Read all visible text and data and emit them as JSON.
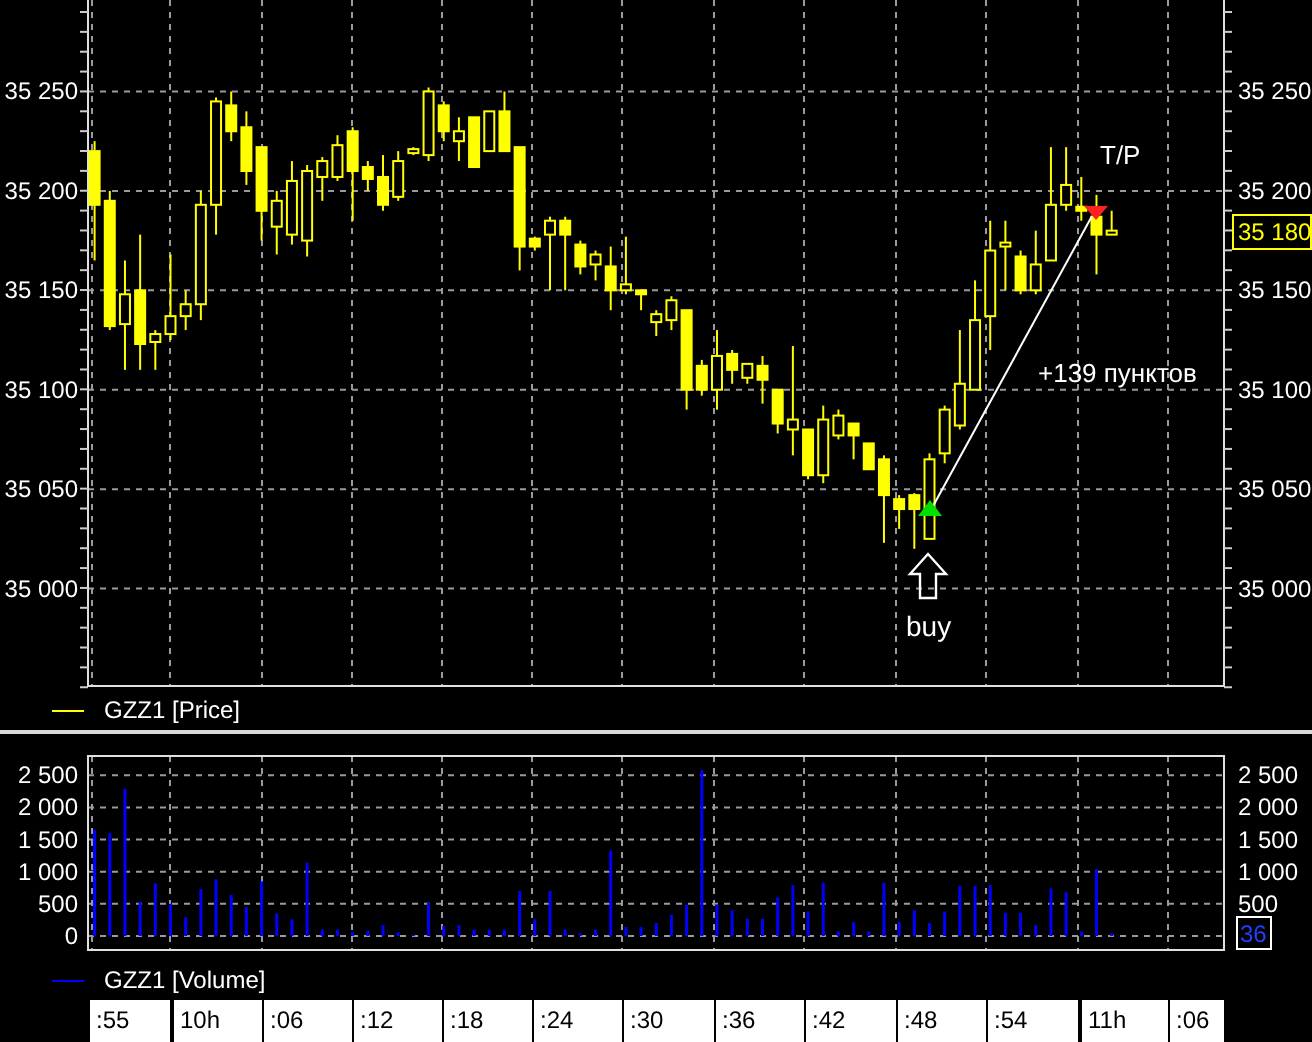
{
  "price_panel": {
    "chart_data": {
      "type": "candlestick",
      "grid": true,
      "ylim": [
        34951,
        35296
      ],
      "yticks": [
        {
          "value": 35000,
          "label": "35 000"
        },
        {
          "value": 35050,
          "label": "35 050"
        },
        {
          "value": 35100,
          "label": "35 100"
        },
        {
          "value": 35150,
          "label": "35 150"
        },
        {
          "value": 35200,
          "label": "35 200"
        },
        {
          "value": 35250,
          "label": "35 250"
        }
      ],
      "series": [
        {
          "name": "GZZ1 [Price]",
          "color": "#ffff00"
        }
      ],
      "ohlc": [
        [
          35220,
          35225,
          35165,
          35193
        ],
        [
          35195,
          35200,
          35130,
          35132
        ],
        [
          35133,
          35165,
          35110,
          35148
        ],
        [
          35150,
          35178,
          35110,
          35123
        ],
        [
          35124,
          35130,
          35110,
          35128
        ],
        [
          35128,
          35168,
          35125,
          35137
        ],
        [
          35137,
          35150,
          35130,
          35143
        ],
        [
          35143,
          35200,
          35135,
          35193
        ],
        [
          35193,
          35247,
          35178,
          35245
        ],
        [
          35243,
          35250,
          35225,
          35230
        ],
        [
          35232,
          35240,
          35203,
          35210
        ],
        [
          35222,
          35222,
          35175,
          35190
        ],
        [
          35182,
          35200,
          35168,
          35195
        ],
        [
          35178,
          35215,
          35173,
          35205
        ],
        [
          35175,
          35213,
          35167,
          35210
        ],
        [
          35207,
          35217,
          35195,
          35215
        ],
        [
          35207,
          35228,
          35205,
          35223
        ],
        [
          35230,
          35232,
          35185,
          35210
        ],
        [
          35212,
          35215,
          35200,
          35206
        ],
        [
          35207,
          35218,
          35190,
          35193
        ],
        [
          35197,
          35220,
          35195,
          35215
        ],
        [
          35219,
          35222,
          35218,
          35221
        ],
        [
          35218,
          35252,
          35215,
          35250
        ],
        [
          35243,
          35245,
          35225,
          35230
        ],
        [
          35225,
          35237,
          35215,
          35230
        ],
        [
          35237,
          35237,
          35212,
          35212
        ],
        [
          35220,
          35240,
          35220,
          35240
        ],
        [
          35240,
          35250,
          35220,
          35220
        ],
        [
          35222,
          35222,
          35160,
          35172
        ],
        [
          35176,
          35177,
          35170,
          35172
        ],
        [
          35178,
          35187,
          35150,
          35185
        ],
        [
          35185,
          35187,
          35150,
          35178
        ],
        [
          35173,
          35175,
          35158,
          35162
        ],
        [
          35163,
          35170,
          35155,
          35168
        ],
        [
          35162,
          35172,
          35140,
          35150
        ],
        [
          35150,
          35177,
          35148,
          35153
        ],
        [
          35150,
          35150,
          35140,
          35148
        ],
        [
          35134,
          35140,
          35127,
          35138
        ],
        [
          35135,
          35147,
          35130,
          35145
        ],
        [
          35140,
          35140,
          35090,
          35100
        ],
        [
          35112,
          35115,
          35097,
          35100
        ],
        [
          35100,
          35130,
          35090,
          35117
        ],
        [
          35118,
          35120,
          35103,
          35110
        ],
        [
          35106,
          35113,
          35103,
          35113
        ],
        [
          35112,
          35117,
          35093,
          35105
        ],
        [
          35100,
          35100,
          35078,
          35083
        ],
        [
          35080,
          35122,
          35067,
          35085
        ],
        [
          35080,
          35080,
          35055,
          35057
        ],
        [
          35057,
          35092,
          35053,
          35085
        ],
        [
          35077,
          35090,
          35075,
          35087
        ],
        [
          35083,
          35083,
          35065,
          35077
        ],
        [
          35073,
          35073,
          35060,
          35060
        ],
        [
          35065,
          35067,
          35023,
          35047
        ],
        [
          35045,
          35047,
          35030,
          35040
        ],
        [
          35047,
          35048,
          35020,
          35040
        ],
        [
          35025,
          35068,
          35025,
          35065
        ],
        [
          35068,
          35092,
          35063,
          35090
        ],
        [
          35082,
          35130,
          35080,
          35103
        ],
        [
          35100,
          35155,
          35100,
          35135
        ],
        [
          35137,
          35185,
          35120,
          35170
        ],
        [
          35172,
          35185,
          35150,
          35174
        ],
        [
          35167,
          35170,
          35148,
          35150
        ],
        [
          35150,
          35180,
          35148,
          35163
        ],
        [
          35165,
          35222,
          35165,
          35193
        ],
        [
          35193,
          35222,
          35190,
          35203
        ],
        [
          35192,
          35207,
          35185,
          35190
        ],
        [
          35187,
          35198,
          35158,
          35178
        ],
        [
          35178,
          35190,
          35178,
          35180
        ]
      ]
    },
    "right_axis_labels": [
      "35 250",
      "35 200",
      "35 150",
      "35 100",
      "35 050",
      "35 000"
    ],
    "last_price": "35 180",
    "annotations": {
      "take_profit": "T/P",
      "profit": "+139 пунктов",
      "entry": "buy"
    }
  },
  "volume_panel": {
    "chart_data": {
      "type": "bar",
      "grid": true,
      "ylim": [
        0,
        2800
      ],
      "yticks": [
        {
          "value": 0,
          "label": "0"
        },
        {
          "value": 500,
          "label": "500"
        },
        {
          "value": 1000,
          "label": "1 000"
        },
        {
          "value": 1500,
          "label": "1 500"
        },
        {
          "value": 2000,
          "label": "2 000"
        },
        {
          "value": 2500,
          "label": "2 500"
        }
      ],
      "series": [
        {
          "name": "GZZ1 [Volume]",
          "color": "#0000ff",
          "values": [
            1650,
            1600,
            2290,
            530,
            820,
            500,
            290,
            730,
            880,
            640,
            450,
            850,
            350,
            260,
            1140,
            100,
            100,
            60,
            80,
            170,
            60,
            20,
            520,
            150,
            170,
            100,
            100,
            100,
            700,
            260,
            700,
            100,
            40,
            100,
            1330,
            140,
            140,
            200,
            330,
            490,
            2580,
            490,
            400,
            270,
            270,
            600,
            790,
            380,
            830,
            70,
            220,
            70,
            830,
            220,
            400,
            200,
            380,
            780,
            780,
            790,
            360,
            360,
            170,
            740,
            680,
            70,
            1040,
            40
          ]
        }
      ]
    },
    "right_axis_labels": [
      "2 500",
      "2 000",
      "1 500",
      "1 000",
      "500"
    ],
    "last_volume": "36"
  },
  "time_axis": [
    {
      "label": ":55",
      "major": false
    },
    {
      "label": "10h",
      "major": true
    },
    {
      "label": ":06",
      "major": false
    },
    {
      "label": ":12",
      "major": false
    },
    {
      "label": ":18",
      "major": false
    },
    {
      "label": ":24",
      "major": false
    },
    {
      "label": ":30",
      "major": false
    },
    {
      "label": ":36",
      "major": false
    },
    {
      "label": ":42",
      "major": false
    },
    {
      "label": ":48",
      "major": false
    },
    {
      "label": ":54",
      "major": false
    },
    {
      "label": "11h",
      "major": true
    },
    {
      "label": ":06",
      "major": false
    }
  ]
}
